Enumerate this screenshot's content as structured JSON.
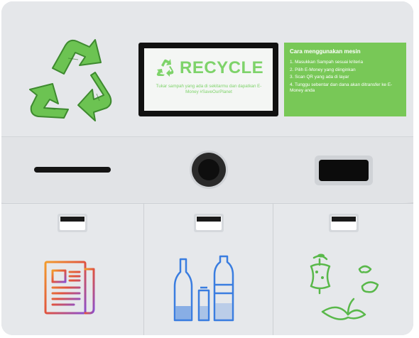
{
  "screen": {
    "title": "RECYCLE",
    "message": "Tukar sampah yang ada di sekitarmu dan dapatkan E-Money #SaveOurPlanet"
  },
  "guide": {
    "title": "Cara menggunakan mesin",
    "steps": [
      "1. Masukkan Sampah sesuai kriteria",
      "2. Pilih E-Money yang diinginkan",
      "3. Scan QR yang ada di layar",
      "4. Tunggu sebentar dan dana akan ditransfer ke E-Money anda"
    ]
  },
  "colors": {
    "accent_green": "#78c857",
    "body": "#e3e5e8"
  },
  "icons": {
    "logo": "recycle-icon",
    "slots": [
      "paper-slot",
      "bottle-hole",
      "can-slot"
    ],
    "bins": [
      "paper-document-icon",
      "bottles-and-can-icon",
      "organic-waste-icon"
    ]
  }
}
